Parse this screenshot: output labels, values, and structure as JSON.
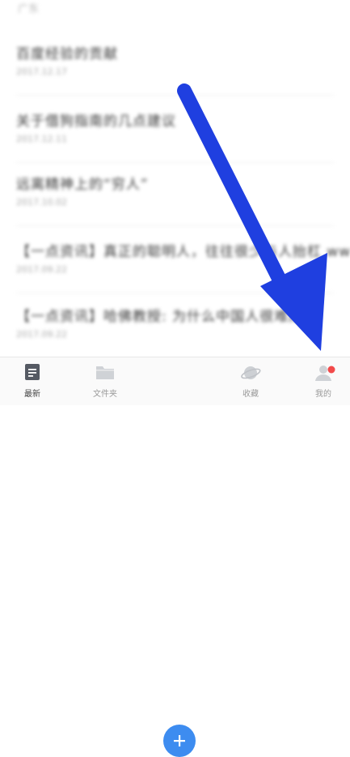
{
  "list": {
    "top_fragment": "广东",
    "items": [
      {
        "title": "百度经验的贡献",
        "date": "2017.12.17"
      },
      {
        "title": "关于借狗指南的几点建议",
        "date": "2017.12.11"
      },
      {
        "title": "远离精神上的“穷人”",
        "date": "2017.10.02"
      },
      {
        "title": "【一点资讯】真正的聪明人，往往很少与人抬杠 ww...",
        "date": "2017.09.22"
      },
      {
        "title": "【一点资讯】哈佛教授: 为什么中国人很难成...",
        "date": "2017.09.22"
      }
    ]
  },
  "tabbar": {
    "latest": "最新",
    "folder": "文件夹",
    "add": "+",
    "favorites": "收藏",
    "mine": "我的"
  },
  "colors": {
    "accent": "#3d8cf0",
    "arrow": "#1f3fe0",
    "badge": "#f24a4a"
  }
}
